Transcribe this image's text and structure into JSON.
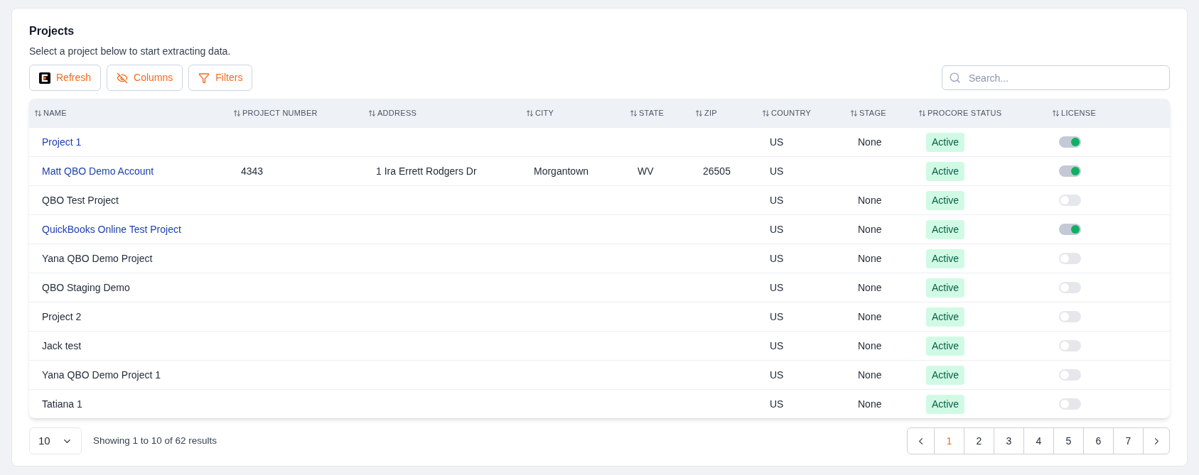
{
  "title": "Projects",
  "subtitle": "Select a project below to start extracting data.",
  "toolbar": [
    {
      "kind": "logo",
      "label": "Refresh"
    },
    {
      "kind": "columns",
      "label": "Columns"
    },
    {
      "kind": "filter",
      "label": "Filters"
    }
  ],
  "search": {
    "placeholder": "Search..."
  },
  "table": {
    "columns": [
      "NAME",
      "PROJECT NUMBER",
      "ADDRESS",
      "CITY",
      "STATE",
      "ZIP",
      "COUNTRY",
      "STAGE",
      "PROCORE STATUS",
      "LICENSE"
    ],
    "rows": [
      {
        "name": "Project 1",
        "link": true,
        "project_number": "",
        "address": "",
        "city": "",
        "state": "",
        "zip": "",
        "country": "US",
        "stage": "None",
        "status": "Active",
        "license": true
      },
      {
        "name": "Matt QBO Demo Account",
        "link": true,
        "project_number": "4343",
        "address": "1 Ira Errett Rodgers Dr",
        "city": "Morgantown",
        "state": "WV",
        "zip": "26505",
        "country": "US",
        "stage": "",
        "status": "Active",
        "license": true
      },
      {
        "name": "QBO Test Project",
        "link": false,
        "project_number": "",
        "address": "",
        "city": "",
        "state": "",
        "zip": "",
        "country": "US",
        "stage": "None",
        "status": "Active",
        "license": false
      },
      {
        "name": "QuickBooks Online Test Project",
        "link": true,
        "project_number": "",
        "address": "",
        "city": "",
        "state": "",
        "zip": "",
        "country": "US",
        "stage": "None",
        "status": "Active",
        "license": true
      },
      {
        "name": "Yana QBO Demo Project",
        "link": false,
        "project_number": "",
        "address": "",
        "city": "",
        "state": "",
        "zip": "",
        "country": "US",
        "stage": "None",
        "status": "Active",
        "license": false
      },
      {
        "name": "QBO Staging Demo",
        "link": false,
        "project_number": "",
        "address": "",
        "city": "",
        "state": "",
        "zip": "",
        "country": "US",
        "stage": "None",
        "status": "Active",
        "license": false
      },
      {
        "name": "Project 2",
        "link": false,
        "project_number": "",
        "address": "",
        "city": "",
        "state": "",
        "zip": "",
        "country": "US",
        "stage": "None",
        "status": "Active",
        "license": false
      },
      {
        "name": "Jack test",
        "link": false,
        "project_number": "",
        "address": "",
        "city": "",
        "state": "",
        "zip": "",
        "country": "US",
        "stage": "None",
        "status": "Active",
        "license": false
      },
      {
        "name": "Yana QBO Demo Project 1",
        "link": false,
        "project_number": "",
        "address": "",
        "city": "",
        "state": "",
        "zip": "",
        "country": "US",
        "stage": "None",
        "status": "Active",
        "license": false
      },
      {
        "name": "Tatiana 1",
        "link": false,
        "project_number": "",
        "address": "",
        "city": "",
        "state": "",
        "zip": "",
        "country": "US",
        "stage": "None",
        "status": "Active",
        "license": false
      }
    ]
  },
  "page_size": "10",
  "summary": "Showing 1 to 10 of 62 results",
  "pages": [
    {
      "label": "1",
      "selected": true
    },
    {
      "label": "2",
      "selected": false
    },
    {
      "label": "3",
      "selected": false
    },
    {
      "label": "4",
      "selected": false
    },
    {
      "label": "5",
      "selected": false
    },
    {
      "label": "6",
      "selected": false
    },
    {
      "label": "7",
      "selected": false
    }
  ]
}
